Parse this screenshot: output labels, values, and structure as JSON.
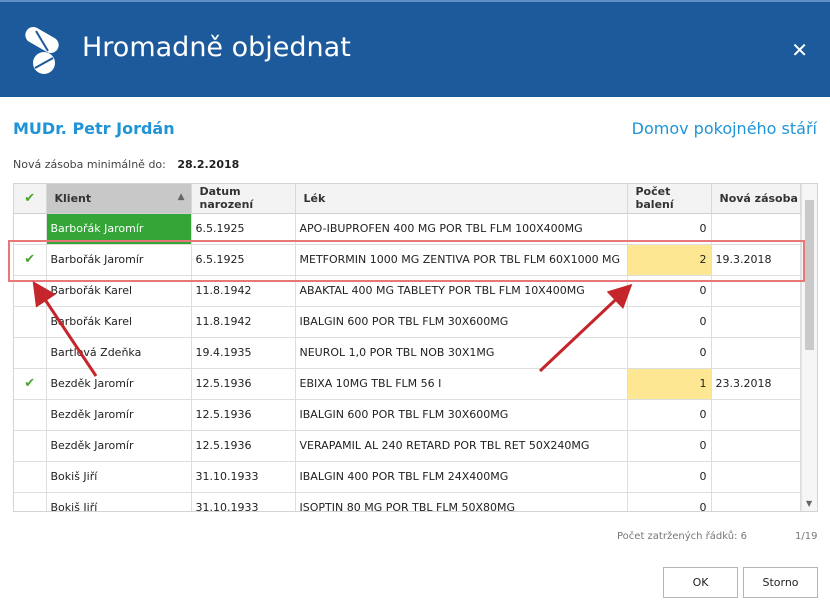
{
  "dialog": {
    "title": "Hromadně objednat",
    "close_icon": "close-icon",
    "logo_icon": "pills-icon"
  },
  "doctor": "MUDr. Petr Jordán",
  "facility": "Domov pokojného stáří",
  "min_stock": {
    "label": "Nová zásoba minimálně do:",
    "date": "28.2.2018"
  },
  "table": {
    "headers": {
      "check": "✔",
      "client": "Klient",
      "dob": "Datum narození",
      "drug": "Lék",
      "count": "Počet balení",
      "stock": "Nová zásoba"
    },
    "rows": [
      {
        "check": "",
        "client": "Barbořák Jaromír",
        "dob": "6.5.1925",
        "drug": "APO-IBUPROFEN 400 MG POR TBL FLM 100X400MG",
        "count": "0",
        "stock": ""
      },
      {
        "check": "✔",
        "client": "Barbořák Jaromír",
        "dob": "6.5.1925",
        "drug": "METFORMIN 1000 MG ZENTIVA POR TBL FLM 60X1000 MG",
        "count": "2",
        "stock": "19.3.2018"
      },
      {
        "check": "",
        "client": "Barbořák Karel",
        "dob": "11.8.1942",
        "drug": "ABAKTAL 400 MG TABLETY POR TBL FLM 10X400MG",
        "count": "0",
        "stock": ""
      },
      {
        "check": "",
        "client": "Barbořák Karel",
        "dob": "11.8.1942",
        "drug": "IBALGIN 600 POR TBL FLM 30X600MG",
        "count": "0",
        "stock": ""
      },
      {
        "check": "",
        "client": "Bartlová Zdeňka",
        "dob": "19.4.1935",
        "drug": "NEUROL 1,0 POR TBL NOB 30X1MG",
        "count": "0",
        "stock": ""
      },
      {
        "check": "✔",
        "client": "Bezděk Jaromír",
        "dob": "12.5.1936",
        "drug": "EBIXA 10MG TBL FLM 56 I",
        "count": "1",
        "stock": "23.3.2018"
      },
      {
        "check": "",
        "client": "Bezděk Jaromír",
        "dob": "12.5.1936",
        "drug": "IBALGIN 600 POR TBL FLM 30X600MG",
        "count": "0",
        "stock": ""
      },
      {
        "check": "",
        "client": "Bezděk Jaromír",
        "dob": "12.5.1936",
        "drug": "VERAPAMIL AL 240 RETARD POR TBL RET 50X240MG",
        "count": "0",
        "stock": ""
      },
      {
        "check": "",
        "client": "Bokiš Jiří",
        "dob": "31.10.1933",
        "drug": "IBALGIN 400 POR TBL FLM 24X400MG",
        "count": "0",
        "stock": ""
      },
      {
        "check": "",
        "client": "Bokiš Jiří",
        "dob": "31.10.1933",
        "drug": "ISOPTIN 80 MG POR TBL FLM 50X80MG",
        "count": "0",
        "stock": ""
      }
    ]
  },
  "footer": {
    "checked_count": "Počet zatržených řádků: 6",
    "page": "1/19"
  },
  "buttons": {
    "ok": "OK",
    "cancel": "Storno"
  }
}
